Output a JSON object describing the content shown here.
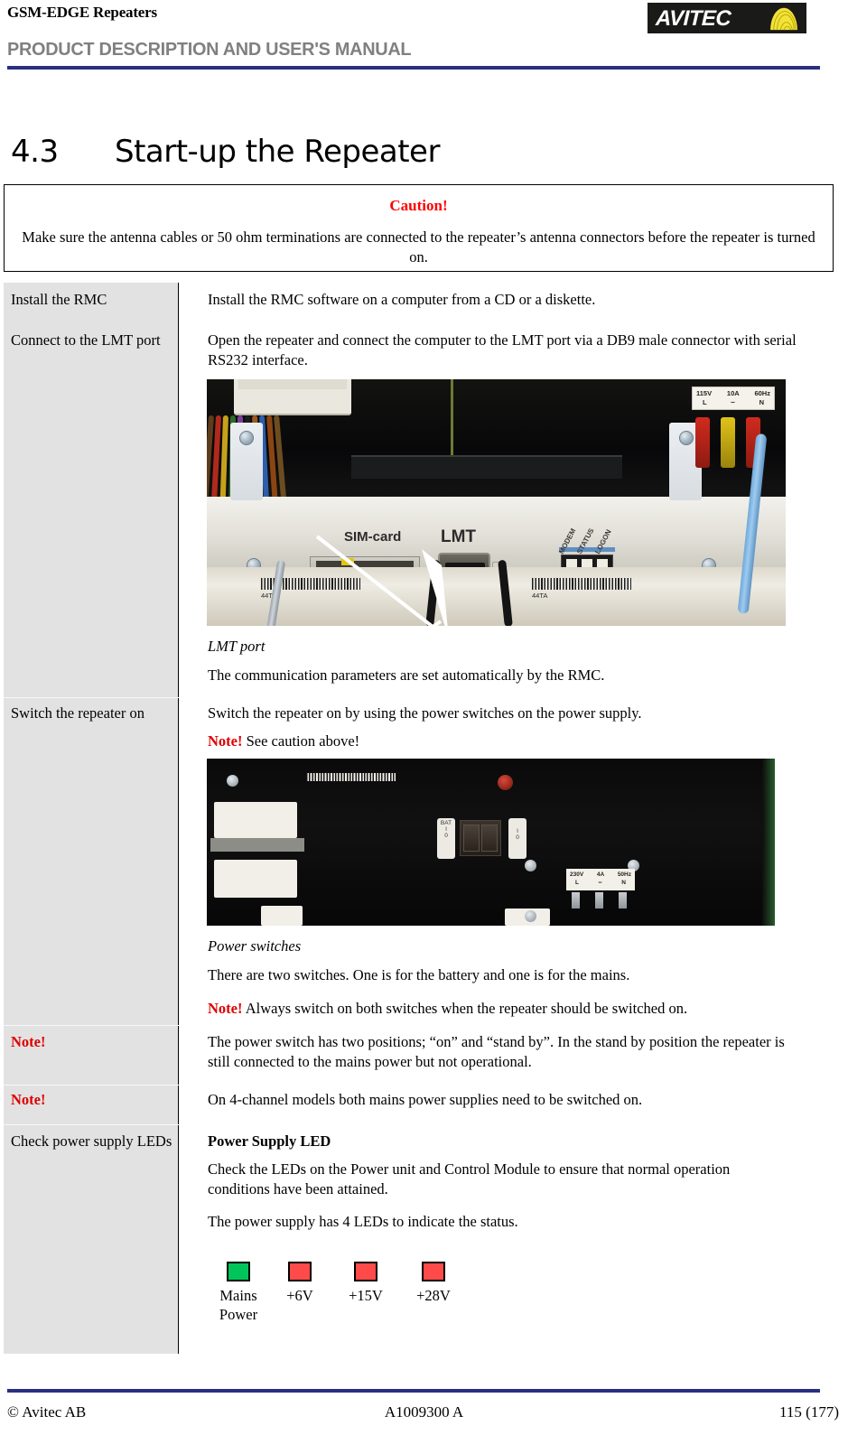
{
  "header": {
    "doc_family": "GSM-EDGE Repeaters",
    "manual_title": "PRODUCT DESCRIPTION AND USER'S MANUAL",
    "logo_text": "AVITEC",
    "rule_color": "#2a2f7f"
  },
  "section": {
    "number": "4.3",
    "title": "Start-up the Repeater"
  },
  "caution": {
    "heading": "Caution!",
    "heading_color": "#ff0000",
    "body": "Make sure the antenna cables or 50 ohm terminations are connected to the repeater’s antenna connectors before the repeater is turned on."
  },
  "steps": [
    {
      "label": "Install the RMC",
      "body": "Install the RMC software on a computer from a CD or a diskette."
    },
    {
      "label": "Connect to the LMT port",
      "body": "Open the repeater and connect the computer to the LMT port via a DB9 male connector with serial RS232 interface.",
      "figure_caption": "LMT port",
      "body_after": "The communication parameters are set automatically by the RMC."
    },
    {
      "label": "Switch the repeater on",
      "body": "Switch the repeater on by using the power switches on the power supply.",
      "note_keyword": "Note!",
      "note_body": "See caution above!",
      "figure_caption": "Power switches",
      "body_after": "There are two switches. One is for the battery and one is for the mains.",
      "note2_keyword": "Note!",
      "note2_body": "Always switch on both switches when the repeater should be switched on."
    },
    {
      "label": "Note!",
      "label_is_note": true,
      "body": "The power switch has two positions; “on” and “stand by”. In the stand by position the repeater is still connected to the mains power but not operational."
    },
    {
      "label": "Note!",
      "label_is_note": true,
      "body": "On 4-channel models both mains power supplies need to be switched on."
    },
    {
      "label": "Check power supply LEDs",
      "subhead": "Power Supply LED",
      "body": "Check the LEDs on the Power unit and Control Module to ensure that normal operation conditions have been attained.",
      "body_after": "The power supply has 4 LEDs to indicate the status."
    }
  ],
  "photo_lmt": {
    "label_sim": "SIM-card",
    "label_lmt": "LMT",
    "label_led_modem": "MODEM",
    "label_led_status": "STATUS",
    "label_led_logon": "LOGON",
    "mains_label_line1_v": "115V",
    "mains_label_line1_a": "10A",
    "mains_label_line1_hz": "60Hz",
    "mains_label_line2_l": "L",
    "mains_label_line2_n": "N",
    "barcode_left_text": "44TF",
    "barcode_right_text": "44TA"
  },
  "photo_switches": {
    "switch_left_top": "BAT",
    "switch_left_on": "I",
    "switch_left_off": "0",
    "switch_right_on": "I",
    "switch_right_off": "0",
    "mains_label_v": "230V",
    "mains_label_a": "4A",
    "mains_label_hz": "50Hz",
    "mains_label_l": "L",
    "mains_label_n": "N"
  },
  "leds": [
    {
      "name": "Mains Power",
      "color": "#00c65a"
    },
    {
      "name": "+6V",
      "color": "#ff4a4a"
    },
    {
      "name": "+15V",
      "color": "#ff4a4a"
    },
    {
      "name": "+28V",
      "color": "#ff4a4a"
    }
  ],
  "footer": {
    "copyright": "© Avitec AB",
    "doc_number": "A1009300 A",
    "page": "115 (177)"
  }
}
